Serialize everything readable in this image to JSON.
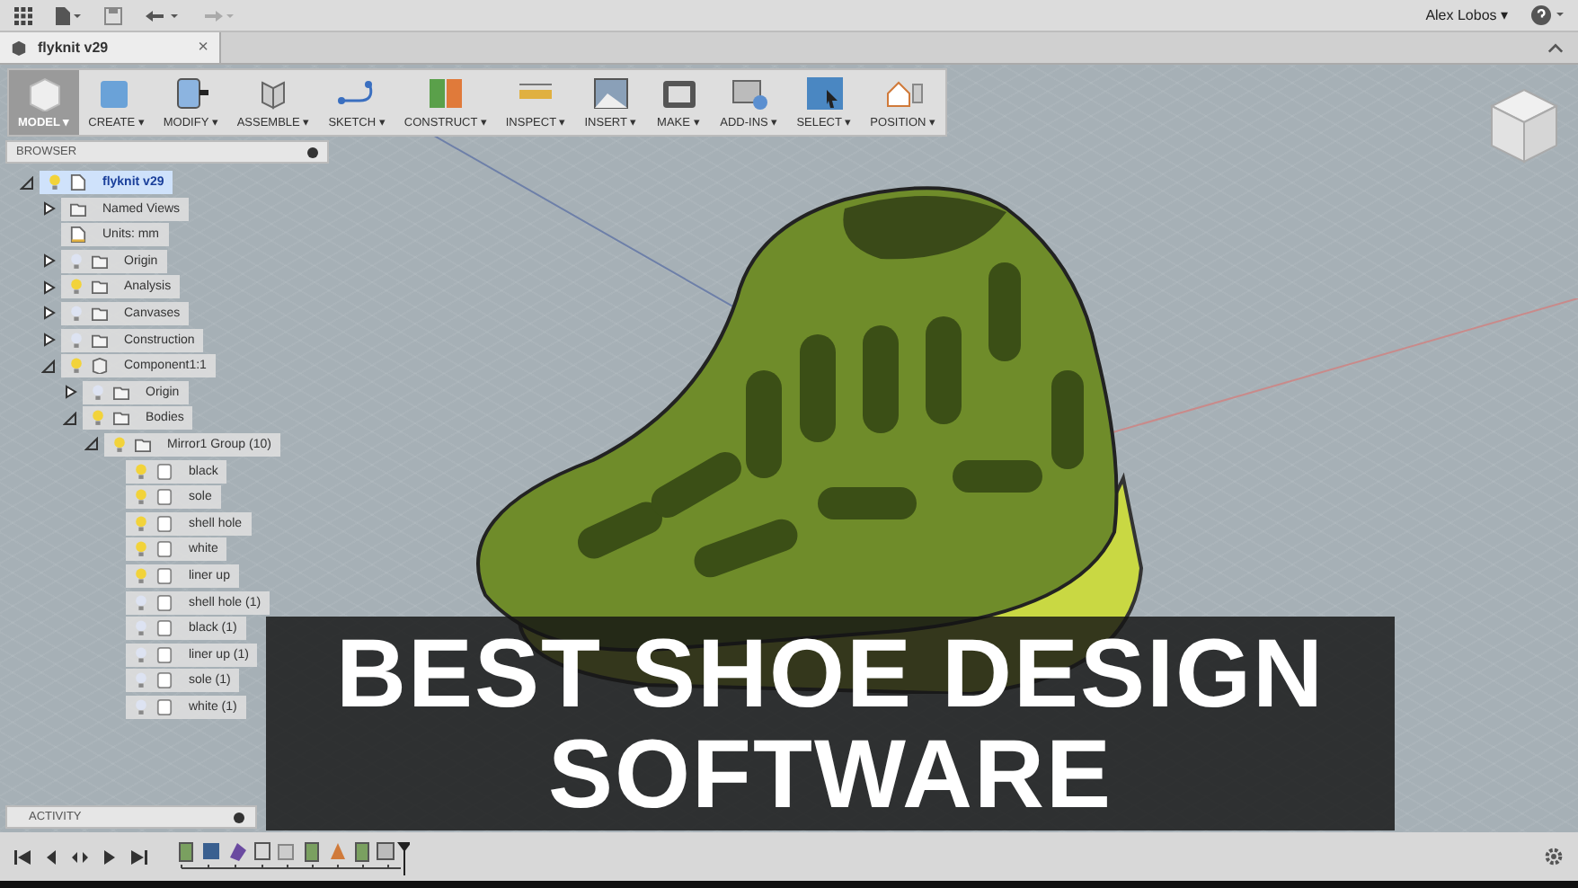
{
  "app_bar": {
    "user": "Alex Lobos ▾"
  },
  "document_tab": {
    "title": "flyknit v29",
    "close": "×"
  },
  "toolbar": [
    {
      "label": "MODEL ▾",
      "kind": "workspace",
      "selected": true
    },
    {
      "label": "CREATE ▾",
      "kind": "create",
      "selected": false
    },
    {
      "label": "MODIFY ▾",
      "kind": "modify",
      "selected": false
    },
    {
      "label": "ASSEMBLE ▾",
      "kind": "assemble",
      "selected": false
    },
    {
      "label": "SKETCH ▾",
      "kind": "sketch",
      "selected": false
    },
    {
      "label": "CONSTRUCT ▾",
      "kind": "construct",
      "selected": false
    },
    {
      "label": "INSPECT ▾",
      "kind": "inspect",
      "selected": false
    },
    {
      "label": "INSERT ▾",
      "kind": "insert",
      "selected": false
    },
    {
      "label": "MAKE ▾",
      "kind": "make",
      "selected": false
    },
    {
      "label": "ADD-INS ▾",
      "kind": "addins",
      "selected": false
    },
    {
      "label": "SELECT ▾",
      "kind": "select",
      "selected": false
    },
    {
      "label": "POSITION ▾",
      "kind": "position",
      "selected": false
    }
  ],
  "browser": {
    "title": "BROWSER",
    "tree": [
      {
        "label": "flyknit v29",
        "kind": "document",
        "visible": true,
        "expanded": true,
        "selected": true,
        "children": [
          {
            "label": "Named Views",
            "kind": "folder",
            "expanded": false,
            "selected": false
          },
          {
            "label": "Units: mm",
            "kind": "units",
            "selected": false
          },
          {
            "label": "Origin",
            "kind": "folder",
            "visible": false,
            "expanded": false,
            "selected": false
          },
          {
            "label": "Analysis",
            "kind": "folder",
            "visible": true,
            "expanded": false,
            "selected": false
          },
          {
            "label": "Canvases",
            "kind": "folder",
            "visible": false,
            "expanded": false,
            "selected": false
          },
          {
            "label": "Construction",
            "kind": "folder",
            "visible": false,
            "expanded": false,
            "selected": false
          },
          {
            "label": "Component1:1",
            "kind": "component",
            "visible": true,
            "expanded": true,
            "selected": false,
            "children": [
              {
                "label": "Origin",
                "kind": "folder",
                "visible": false,
                "expanded": false,
                "selected": false
              },
              {
                "label": "Bodies",
                "kind": "folder",
                "visible": true,
                "expanded": true,
                "selected": false,
                "children": [
                  {
                    "label": "Mirror1 Group (10)",
                    "kind": "folder",
                    "visible": true,
                    "expanded": true,
                    "selected": false,
                    "children": [
                      {
                        "label": "black",
                        "kind": "body",
                        "visible": true,
                        "selected": false
                      },
                      {
                        "label": "sole",
                        "kind": "body",
                        "visible": true,
                        "selected": false
                      },
                      {
                        "label": "shell hole",
                        "kind": "body",
                        "visible": true,
                        "selected": false
                      },
                      {
                        "label": "white",
                        "kind": "body",
                        "visible": true,
                        "selected": false
                      },
                      {
                        "label": "liner up",
                        "kind": "body",
                        "visible": true,
                        "selected": false
                      },
                      {
                        "label": "shell hole (1)",
                        "kind": "body",
                        "visible": false,
                        "selected": false
                      },
                      {
                        "label": "black (1)",
                        "kind": "body",
                        "visible": false,
                        "selected": false
                      },
                      {
                        "label": "liner up (1)",
                        "kind": "body",
                        "visible": false,
                        "selected": false
                      },
                      {
                        "label": "sole (1)",
                        "kind": "body",
                        "visible": false,
                        "selected": false
                      },
                      {
                        "label": "white (1)",
                        "kind": "body",
                        "visible": false,
                        "selected": false
                      }
                    ]
                  }
                ]
              }
            ]
          }
        ]
      }
    ]
  },
  "activity": {
    "title": "ACTIVITY"
  },
  "banner": {
    "lines": [
      "BEST SHOE DESIGN",
      "SOFTWARE"
    ]
  }
}
